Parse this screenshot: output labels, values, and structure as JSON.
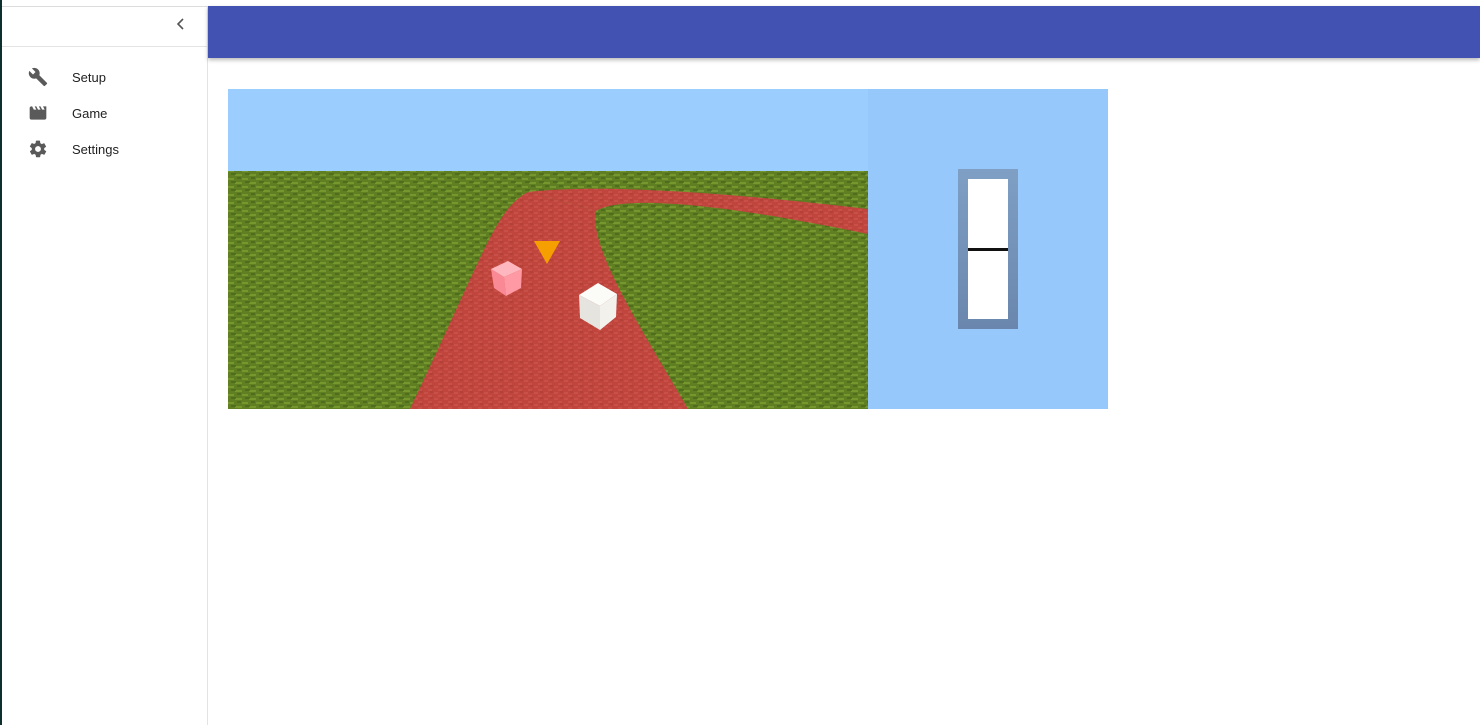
{
  "sidebar": {
    "collapse_icon": "chevron-left-icon",
    "items": [
      {
        "label": "Setup",
        "icon": "wrench-icon"
      },
      {
        "label": "Game",
        "icon": "clapperboard-icon"
      },
      {
        "label": "Settings",
        "icon": "gear-icon"
      }
    ]
  },
  "topbar": {
    "color": "#4152b3"
  },
  "game": {
    "sky_color": "#9bceff",
    "panel_color": "#97c8fb",
    "grass_color": "#5f7f22",
    "track_color": "#c0453d",
    "marker_color": "#f5a000",
    "gauge": {
      "level": 0.5
    }
  }
}
